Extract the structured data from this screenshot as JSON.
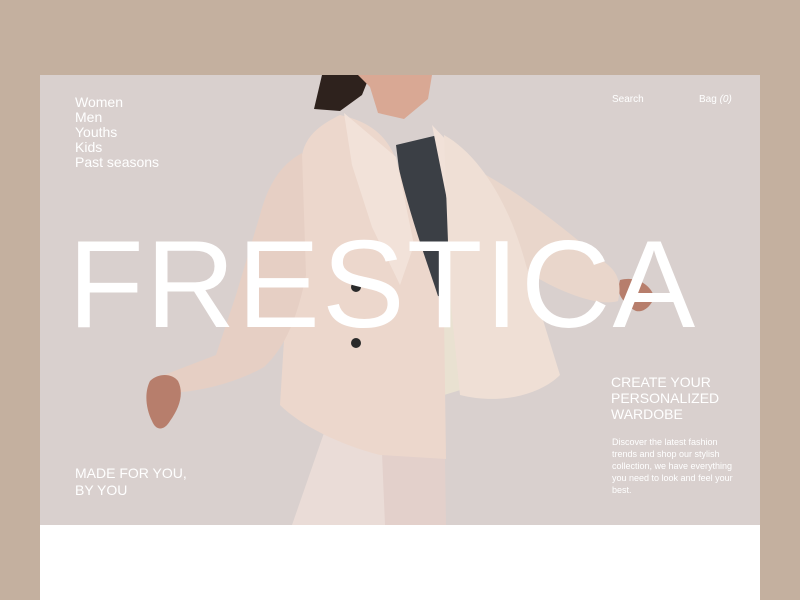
{
  "nav": {
    "items": [
      {
        "label": "Women"
      },
      {
        "label": "Men"
      },
      {
        "label": "Youths"
      },
      {
        "label": "Kids"
      },
      {
        "label": "Past seasons"
      }
    ]
  },
  "header": {
    "search_label": "Search",
    "bag_label": "Bag",
    "bag_count": "(0)"
  },
  "hero": {
    "brand": "FRESTICA",
    "tagline_line1": "MADE FOR YOU,",
    "tagline_line2": "BY YOU",
    "cta_title_line1": "CREATE YOUR",
    "cta_title_line2": "PERSONALIZED",
    "cta_title_line3": "WARDOBE",
    "cta_text": "Discover the latest fashion trends and shop our stylish collection, we have everything you need to look and feel your best."
  },
  "colors": {
    "outer_background": "#c4b09f",
    "hero_background": "#d9d0ce",
    "text": "#ffffff",
    "blazer": "#ecd7cc",
    "blouse": "#3b3f45"
  }
}
